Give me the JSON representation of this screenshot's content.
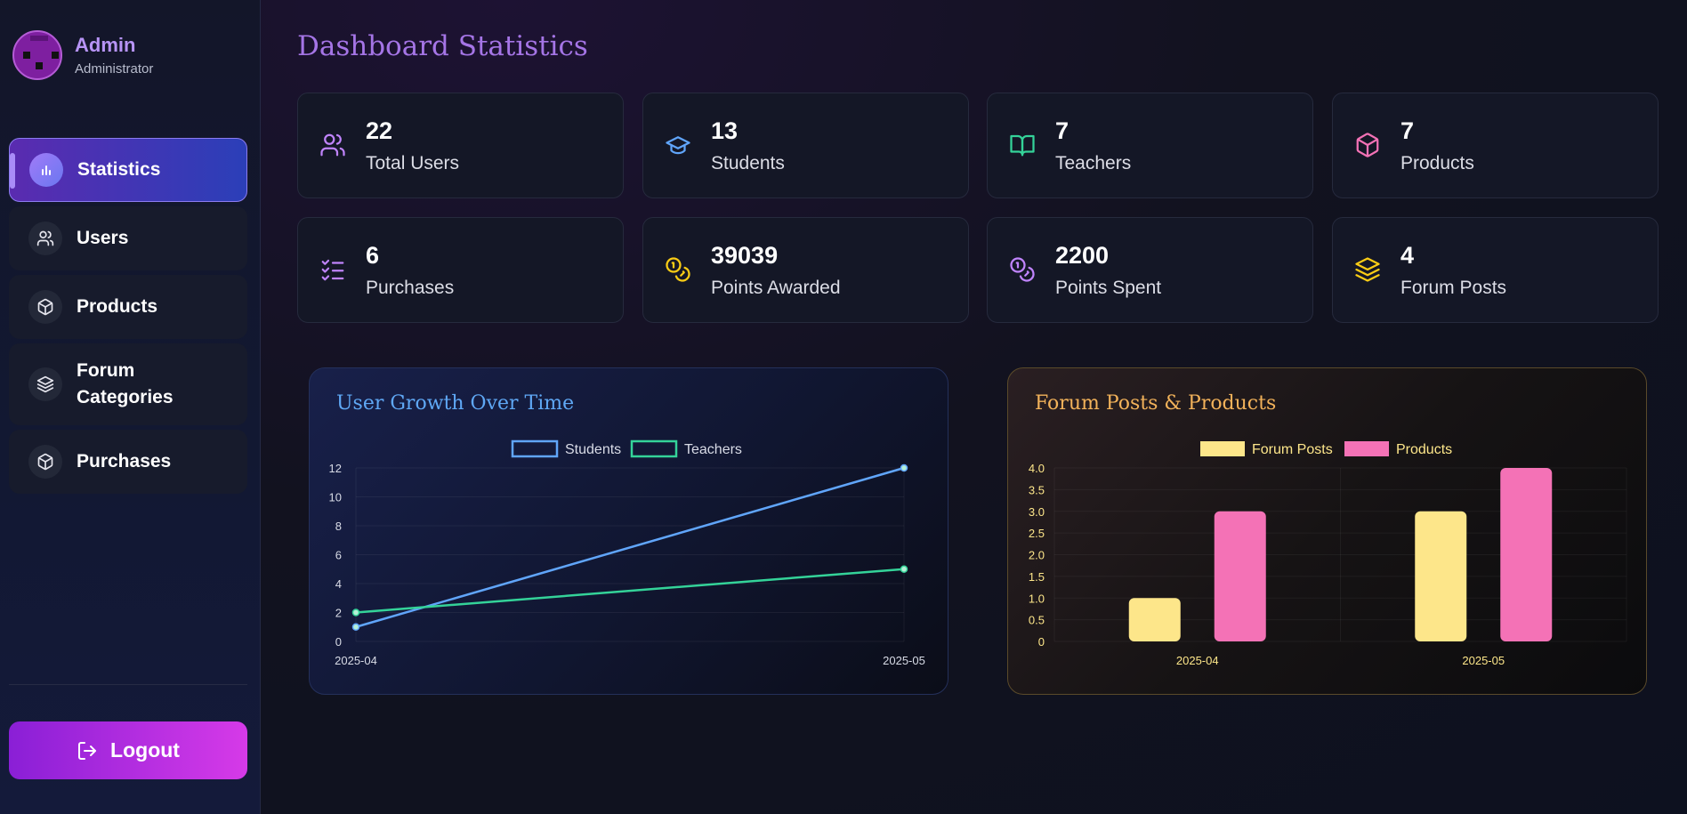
{
  "profile": {
    "name": "Admin",
    "role": "Administrator"
  },
  "nav": {
    "statistics": "Statistics",
    "users": "Users",
    "products": "Products",
    "forum_categories_line1": "Forum",
    "forum_categories_line2": "Categories",
    "purchases": "Purchases"
  },
  "logout_label": "Logout",
  "page_title": "Dashboard Statistics",
  "stats": {
    "total_users": {
      "value": "22",
      "label": "Total Users"
    },
    "students": {
      "value": "13",
      "label": "Students"
    },
    "teachers": {
      "value": "7",
      "label": "Teachers"
    },
    "products": {
      "value": "7",
      "label": "Products"
    },
    "purchases": {
      "value": "6",
      "label": "Purchases"
    },
    "points_awarded": {
      "value": "39039",
      "label": "Points Awarded"
    },
    "points_spent": {
      "value": "2200",
      "label": "Points Spent"
    },
    "forum_posts": {
      "value": "4",
      "label": "Forum Posts"
    }
  },
  "colors": {
    "accent": "#a575e6",
    "students": "#60a5fa",
    "teachers": "#34d399",
    "forum_posts": "#fde68a",
    "products": "#f472b6"
  },
  "chart_data": [
    {
      "type": "line",
      "title": "User Growth Over Time",
      "x": [
        "2025-04",
        "2025-05"
      ],
      "ylim": [
        0,
        12
      ],
      "yticks": [
        "0",
        "2",
        "4",
        "6",
        "8",
        "10",
        "12"
      ],
      "legend": "top",
      "grid": true,
      "series": [
        {
          "name": "Students",
          "values": [
            1,
            12
          ]
        },
        {
          "name": "Teachers",
          "values": [
            2,
            5
          ]
        }
      ]
    },
    {
      "type": "bar",
      "title": "Forum Posts & Products",
      "categories": [
        "2025-04",
        "2025-05"
      ],
      "ylim": [
        0,
        4
      ],
      "yticks": [
        "0",
        "0.5",
        "1.0",
        "1.5",
        "2.0",
        "2.5",
        "3.0",
        "3.5",
        "4.0"
      ],
      "legend": "top",
      "grid": true,
      "series": [
        {
          "name": "Forum Posts",
          "values": [
            1,
            3
          ]
        },
        {
          "name": "Products",
          "values": [
            3,
            4
          ]
        }
      ]
    }
  ]
}
